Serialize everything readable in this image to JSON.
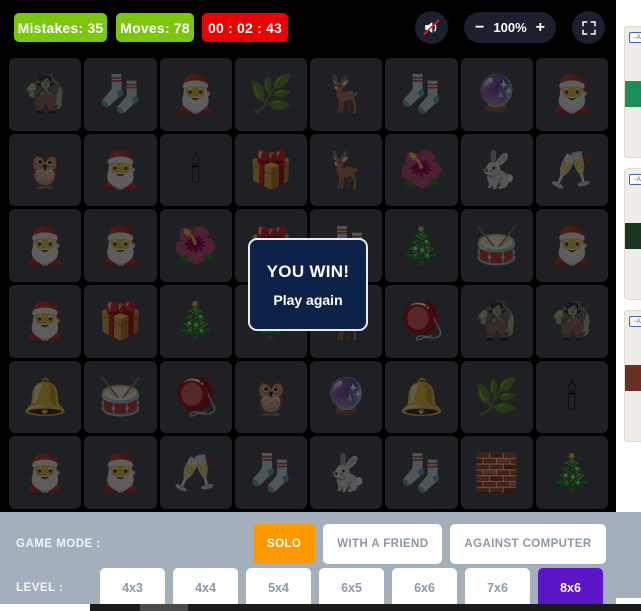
{
  "toolbar": {
    "mistakes": "Mistakes: 35",
    "moves": "Moves: 78",
    "timer": "00 : 02 : 43",
    "zoom_minus": "−",
    "zoom_value": "100%",
    "zoom_plus": "+",
    "mute_icon": "speaker-muted-icon",
    "fullscreen_icon": "fullscreen-icon",
    "colors": {
      "badge_green": "#7ac70c",
      "badge_red": "#ee0000",
      "toolbar_bg": "#000000",
      "pill_bg": "#1b1f2e"
    }
  },
  "modal": {
    "title": "YOU WIN!",
    "action": "Play again",
    "bg": "#0d2249",
    "border": "#e8eaf0"
  },
  "board": {
    "columns": 8,
    "rows": 6,
    "card_bg": "#53565c",
    "cards": [
      {
        "name": "elf",
        "glyph": "🧌"
      },
      {
        "name": "stockings-garland",
        "glyph": "🧦"
      },
      {
        "name": "santa-bell",
        "glyph": "🎅"
      },
      {
        "name": "mistletoe",
        "glyph": "🌿"
      },
      {
        "name": "santa-reindeer",
        "glyph": "🦌"
      },
      {
        "name": "stocking-gifts",
        "glyph": "🧦"
      },
      {
        "name": "snow-globe",
        "glyph": "🔮"
      },
      {
        "name": "santa-sack",
        "glyph": "🎅"
      },
      {
        "name": "owl",
        "glyph": "🦉"
      },
      {
        "name": "santa-waving",
        "glyph": "🎅"
      },
      {
        "name": "candles",
        "glyph": "🕯"
      },
      {
        "name": "gift-boxes",
        "glyph": "🎁"
      },
      {
        "name": "reindeer",
        "glyph": "🦌"
      },
      {
        "name": "holly-bells",
        "glyph": "🌺"
      },
      {
        "name": "bunny",
        "glyph": "🐇"
      },
      {
        "name": "nutcracker",
        "glyph": "🥂"
      },
      {
        "name": "santa-gift-bag",
        "glyph": "🎅"
      },
      {
        "name": "santa-gift-bag-2",
        "glyph": "🎅"
      },
      {
        "name": "holly-bells-2",
        "glyph": "🌺"
      },
      {
        "name": "gift-box-blue",
        "glyph": "🎁"
      },
      {
        "name": "stockings-garland-2",
        "glyph": "🧦"
      },
      {
        "name": "ornament",
        "glyph": "🎄"
      },
      {
        "name": "drum",
        "glyph": "🥁"
      },
      {
        "name": "santa-bell-2",
        "glyph": "🎅"
      },
      {
        "name": "santa-list",
        "glyph": "🎅"
      },
      {
        "name": "gift-boxes-2",
        "glyph": "🎁"
      },
      {
        "name": "christmas-tree",
        "glyph": "🎄"
      },
      {
        "name": "pine-branch",
        "glyph": "🌲"
      },
      {
        "name": "reindeer-2",
        "glyph": "🦌"
      },
      {
        "name": "spinning-top",
        "glyph": "🪀"
      },
      {
        "name": "elf-2",
        "glyph": "🧌"
      },
      {
        "name": "elf-3",
        "glyph": "🧌"
      },
      {
        "name": "bells",
        "glyph": "🔔"
      },
      {
        "name": "drum-2",
        "glyph": "🥁"
      },
      {
        "name": "spinning-top-2",
        "glyph": "🪀"
      },
      {
        "name": "owl-2",
        "glyph": "🦉"
      },
      {
        "name": "snow-globe-2",
        "glyph": "🔮"
      },
      {
        "name": "bells-2",
        "glyph": "🔔"
      },
      {
        "name": "mistletoe-2",
        "glyph": "🌿"
      },
      {
        "name": "candles-2",
        "glyph": "🕯"
      },
      {
        "name": "santa-sack-2",
        "glyph": "🎅"
      },
      {
        "name": "santa-waving-2",
        "glyph": "🎅"
      },
      {
        "name": "nutcracker-2",
        "glyph": "🥂"
      },
      {
        "name": "stockings-garland-3",
        "glyph": "🧦"
      },
      {
        "name": "bunny-2",
        "glyph": "🐇"
      },
      {
        "name": "stocking-gifts-2",
        "glyph": "🧦"
      },
      {
        "name": "toy-blocks",
        "glyph": "🧱"
      },
      {
        "name": "ornament-2",
        "glyph": "🎄"
      }
    ]
  },
  "controls": {
    "panel_bg": "#a3b0bc",
    "game_mode_label": "GAME MODE :",
    "level_label": "LEVEL :",
    "modes": [
      {
        "label": "SOLO",
        "active": true
      },
      {
        "label": "WITH A FRIEND",
        "active": false
      },
      {
        "label": "AGAINST COMPUTER",
        "active": false
      }
    ],
    "levels": [
      {
        "label": "4x3",
        "active": false
      },
      {
        "label": "4x4",
        "active": false
      },
      {
        "label": "5x4",
        "active": false
      },
      {
        "label": "6x5",
        "active": false
      },
      {
        "label": "6x6",
        "active": false
      },
      {
        "label": "7x6",
        "active": false
      },
      {
        "label": "8x6",
        "active": true
      }
    ],
    "active_mode_color": "#ff9900",
    "active_level_color": "#5b16c8"
  },
  "side_panel": {
    "cards": [
      {
        "badge": "−A"
      },
      {
        "badge": "−A"
      },
      {
        "badge": "−A"
      }
    ]
  }
}
